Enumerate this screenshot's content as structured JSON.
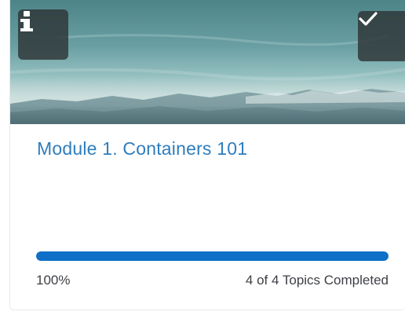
{
  "card": {
    "title": "Module 1. Containers 101",
    "progress": {
      "percent_label": "100%",
      "fraction": 1.0,
      "topics_label": "4 of 4 Topics Completed"
    },
    "icons": {
      "info": "info-icon",
      "complete": "checkmark-icon"
    }
  },
  "colors": {
    "title": "#2f7dbd",
    "progress_fill": "#0d6fc6",
    "progress_track": "#e3e6ea",
    "icon_button_bg": "#2e3436"
  }
}
